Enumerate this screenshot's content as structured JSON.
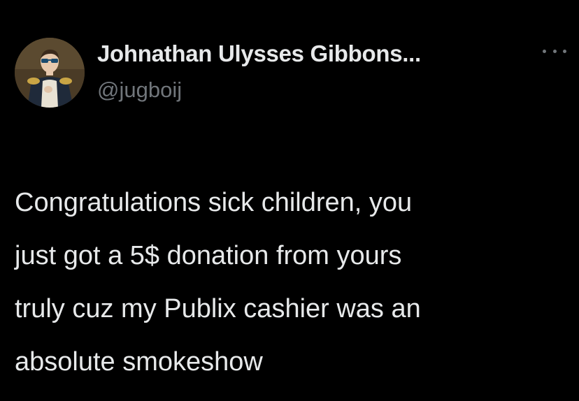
{
  "author": {
    "display_name": "Johnathan Ulysses Gibbons...",
    "handle": "@jugboij",
    "avatar_icon": "portrait-avatar"
  },
  "more_icon": "more-options-icon",
  "tweet": {
    "lines": [
      "Congratulations sick children, you",
      "just got a 5$ donation from yours",
      "truly cuz my Publix cashier was an",
      "absolute smokeshow"
    ]
  },
  "colors": {
    "background": "#000000",
    "primary_text": "#e7e9ea",
    "secondary_text": "#71767b"
  }
}
